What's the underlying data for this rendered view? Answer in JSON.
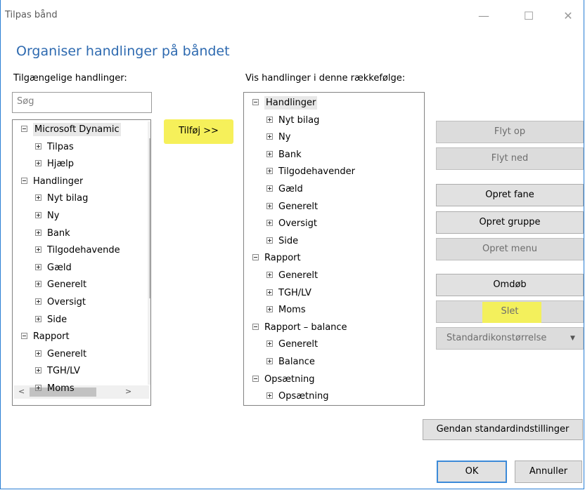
{
  "window": {
    "title": "Tilpas bånd",
    "controls": [
      "—",
      "☐",
      "✕"
    ]
  },
  "heading": "Organiser handlinger på båndet",
  "left": {
    "label": "Tilgængelige handlinger:",
    "search_placeholder": "Søg",
    "items": [
      {
        "text": "Microsoft Dynamic",
        "exp": "minus",
        "level": 0,
        "selected": true
      },
      {
        "text": "Tilpas",
        "exp": "plus",
        "level": 1
      },
      {
        "text": "Hjælp",
        "exp": "plus",
        "level": 1
      },
      {
        "text": "Handlinger",
        "exp": "minus",
        "level": 0
      },
      {
        "text": "Nyt bilag",
        "exp": "plus",
        "level": 1
      },
      {
        "text": "Ny",
        "exp": "plus",
        "level": 1
      },
      {
        "text": "Bank",
        "exp": "plus",
        "level": 1
      },
      {
        "text": "Tilgodehavende",
        "exp": "plus",
        "level": 1
      },
      {
        "text": "Gæld",
        "exp": "plus",
        "level": 1
      },
      {
        "text": "Generelt",
        "exp": "plus",
        "level": 1
      },
      {
        "text": "Oversigt",
        "exp": "plus",
        "level": 1
      },
      {
        "text": "Side",
        "exp": "plus",
        "level": 1
      },
      {
        "text": "Rapport",
        "exp": "minus",
        "level": 0
      },
      {
        "text": "Generelt",
        "exp": "plus",
        "level": 1
      },
      {
        "text": "TGH/LV",
        "exp": "plus",
        "level": 1
      },
      {
        "text": "Moms",
        "exp": "plus",
        "level": 1
      }
    ]
  },
  "add_button": "Tilføj >>",
  "right": {
    "label": "Vis handlinger i denne rækkefølge:",
    "items": [
      {
        "text": "Handlinger",
        "exp": "minus",
        "level": 0,
        "selected": true
      },
      {
        "text": "Nyt bilag",
        "exp": "plus",
        "level": 1
      },
      {
        "text": "Ny",
        "exp": "plus",
        "level": 1
      },
      {
        "text": "Bank",
        "exp": "plus",
        "level": 1
      },
      {
        "text": "Tilgodehavender",
        "exp": "plus",
        "level": 1
      },
      {
        "text": "Gæld",
        "exp": "plus",
        "level": 1
      },
      {
        "text": "Generelt",
        "exp": "plus",
        "level": 1
      },
      {
        "text": "Oversigt",
        "exp": "plus",
        "level": 1
      },
      {
        "text": "Side",
        "exp": "plus",
        "level": 1
      },
      {
        "text": "Rapport",
        "exp": "minus",
        "level": 0
      },
      {
        "text": "Generelt",
        "exp": "plus",
        "level": 1
      },
      {
        "text": "TGH/LV",
        "exp": "plus",
        "level": 1
      },
      {
        "text": "Moms",
        "exp": "plus",
        "level": 1
      },
      {
        "text": "Rapport – balance",
        "exp": "minus",
        "level": 0
      },
      {
        "text": "Generelt",
        "exp": "plus",
        "level": 1
      },
      {
        "text": "Balance",
        "exp": "plus",
        "level": 1
      },
      {
        "text": "Opsætning",
        "exp": "minus",
        "level": 0
      },
      {
        "text": "Opsætning",
        "exp": "plus",
        "level": 1
      }
    ]
  },
  "buttons": {
    "move_up": "Flyt op",
    "move_down": "Flyt ned",
    "create_tab": "Opret fane",
    "create_group": "Opret gruppe",
    "create_menu": "Opret menu",
    "rename": "Omdøb",
    "delete": "Slet",
    "icon_size": "Standardikonstørrelse",
    "restore": "Gendan standardindstillinger",
    "ok": "OK",
    "cancel": "Annuller"
  },
  "colors": {
    "highlight": "#f6f05a",
    "heading": "#2e6ab0",
    "window_border": "#2b7fd4"
  }
}
